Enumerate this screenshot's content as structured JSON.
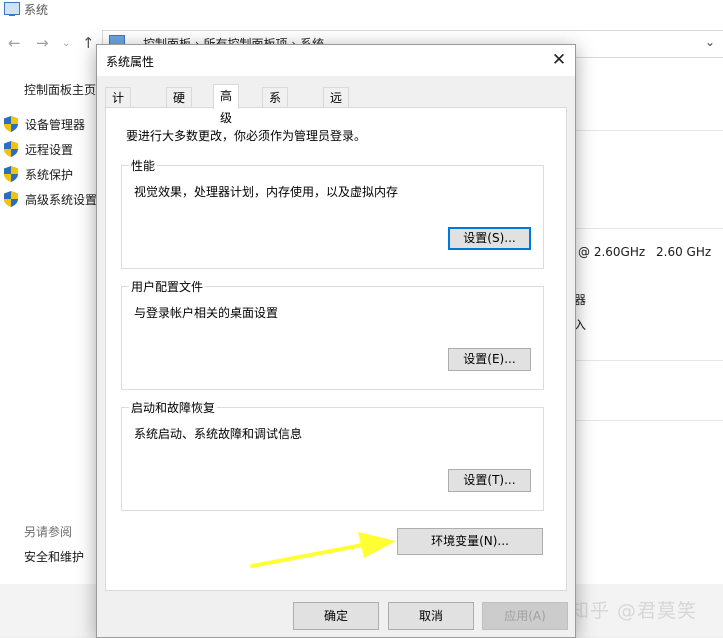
{
  "background_window": {
    "title": "系统",
    "breadcrumb": [
      "控制面板",
      "所有控制面板项",
      "系统"
    ],
    "sidebar": {
      "home": "控制面板主页",
      "links": [
        {
          "label": "设备管理器",
          "icon": "uac-shield-icon"
        },
        {
          "label": "远程设置",
          "icon": "uac-shield-icon"
        },
        {
          "label": "系统保护",
          "icon": "uac-shield-icon"
        },
        {
          "label": "高级系统设置",
          "icon": "uac-shield-icon"
        }
      ],
      "see_also": "另请参阅",
      "security": "安全和维护"
    },
    "processor_clock": "@ 2.60GHz",
    "processor_speed": "2.60 GHz",
    "fragment_1": "器",
    "fragment_2": "入"
  },
  "dialog": {
    "title": "系统属性",
    "close_glyph": "✕",
    "tabs": [
      {
        "label": "计算机名",
        "active": false
      },
      {
        "label": "硬件",
        "active": false
      },
      {
        "label": "高级",
        "active": true
      },
      {
        "label": "系统保护",
        "active": false
      },
      {
        "label": "远程",
        "active": false
      }
    ],
    "admin_note": "要进行大多数更改，你必须作为管理员登录。",
    "groups": [
      {
        "legend": "性能",
        "description": "视觉效果，处理器计划，内存使用，以及虚拟内存",
        "button": "设置(S)..."
      },
      {
        "legend": "用户配置文件",
        "description": "与登录帐户相关的桌面设置",
        "button": "设置(E)..."
      },
      {
        "legend": "启动和故障恢复",
        "description": "系统启动、系统故障和调试信息",
        "button": "设置(T)..."
      }
    ],
    "env_button": "环境变量(N)...",
    "ok": "确定",
    "cancel": "取消",
    "apply": "应用(A)"
  },
  "watermark": "知乎 @君莫笑",
  "colors": {
    "accent": "#0078d7",
    "arrow": "#ffff33",
    "shield_blue": "#2b6cc4",
    "shield_yellow": "#f5c400"
  }
}
